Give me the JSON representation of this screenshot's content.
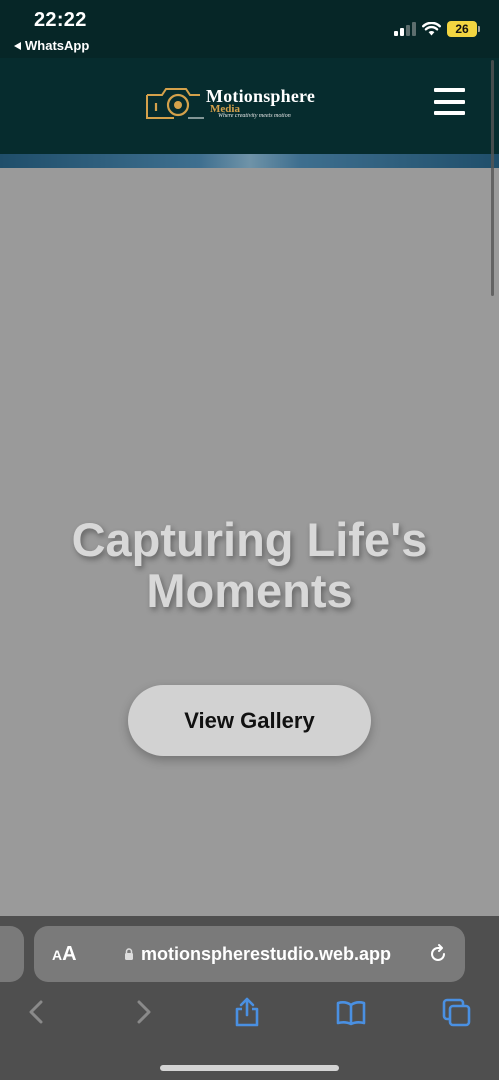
{
  "status_bar": {
    "time": "22:22",
    "back_app": "WhatsApp",
    "battery": "26",
    "battery_color": "#f2d541"
  },
  "header": {
    "logo": {
      "name": "Motionsphere",
      "sub": "Media",
      "tagline": "Where creativity meets motion"
    },
    "menu_icon": "hamburger-icon",
    "background": "#062c2e"
  },
  "hero": {
    "title_line1": "Capturing Life's",
    "title_line2": "Moments",
    "button_label": "View Gallery"
  },
  "browser": {
    "aa_small": "A",
    "aa_big": "A",
    "url": "motionspherestudio.web.app",
    "toolbar": [
      "back-icon",
      "forward-icon",
      "share-icon",
      "bookmarks-icon",
      "tabs-icon"
    ]
  }
}
